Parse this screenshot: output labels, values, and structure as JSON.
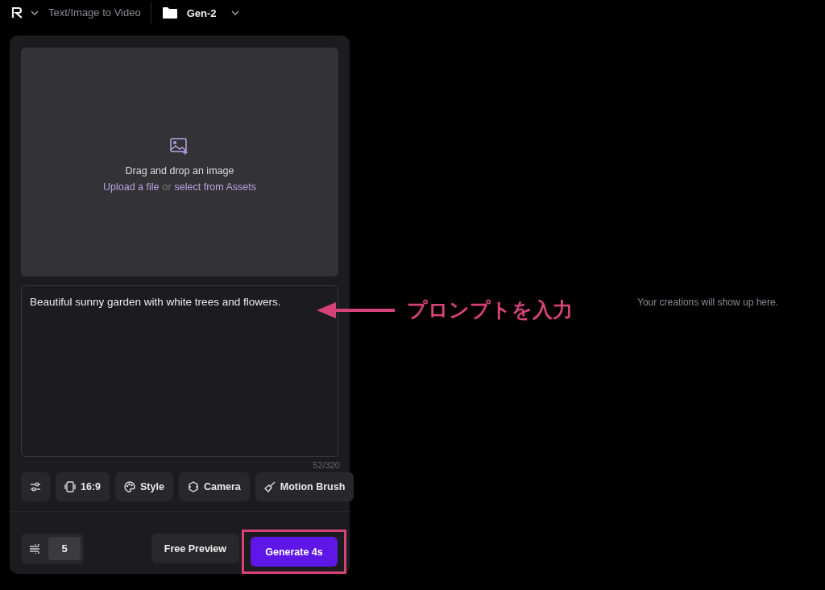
{
  "header": {
    "mode": "Text/Image to Video",
    "folder": "Gen-2"
  },
  "upload": {
    "title": "Drag and drop an image",
    "upload_link": "Upload a file",
    "separator": "or",
    "assets_link": "select from Assets"
  },
  "prompt": {
    "value": "Beautiful sunny garden with white trees and flowers.",
    "counter": "52/320"
  },
  "tools": [
    {
      "kind": "settings"
    },
    {
      "kind": "aspect",
      "label": "16:9"
    },
    {
      "kind": "style",
      "label": "Style"
    },
    {
      "kind": "camera",
      "label": "Camera"
    },
    {
      "kind": "brush",
      "label": "Motion Brush"
    }
  ],
  "motion": {
    "value": "5"
  },
  "buttons": [
    {
      "kind": "secondary",
      "label": "Free Preview"
    },
    {
      "kind": "primary",
      "label": "Generate 4s"
    }
  ],
  "empty_state": "Your creations will show up here.",
  "annotation": {
    "text": "プロンプトを入力"
  }
}
